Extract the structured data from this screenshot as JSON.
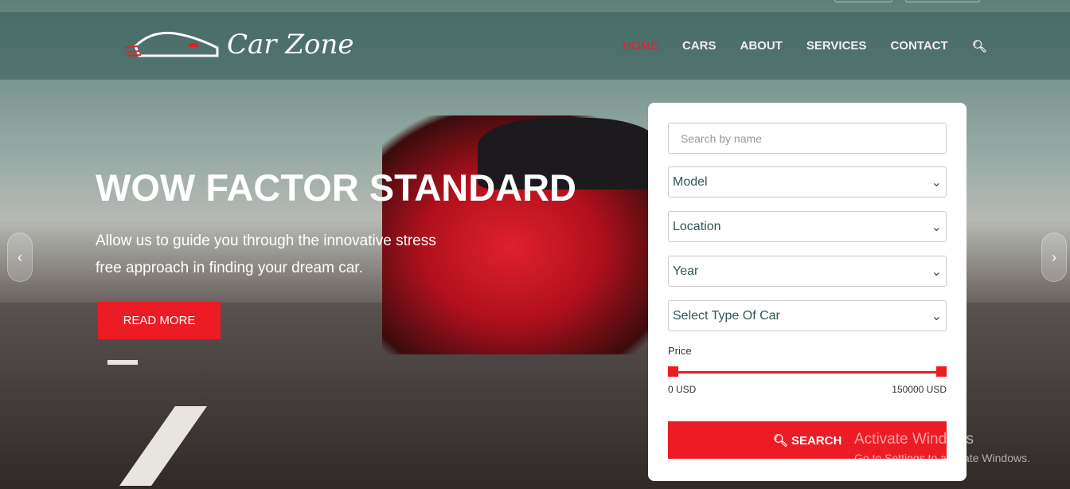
{
  "brand": {
    "name": "Car Zone"
  },
  "nav": {
    "items": [
      {
        "label": "HOME",
        "active": true
      },
      {
        "label": "CARS"
      },
      {
        "label": "ABOUT"
      },
      {
        "label": "SERVICES"
      },
      {
        "label": "CONTACT"
      }
    ],
    "search_icon": "search-icon"
  },
  "hero": {
    "title": "WOW FACTOR STANDARD",
    "subtitle": "Allow us to guide you through the innovative stress free approach in finding your dream car.",
    "button": "READ MORE"
  },
  "search_panel": {
    "name_placeholder": "Search by name",
    "selects": [
      "Model",
      "Location",
      "Year",
      "Select Type Of Car"
    ],
    "price_label": "Price",
    "price_min": "0 USD",
    "price_max": "150000 USD",
    "price_range": [
      0,
      150000
    ],
    "search_button": "SEARCH"
  },
  "watermark": {
    "line1": "Activate Windows",
    "line2": "Go to Settings to activate Windows."
  },
  "colors": {
    "accent": "#ed1c24"
  }
}
